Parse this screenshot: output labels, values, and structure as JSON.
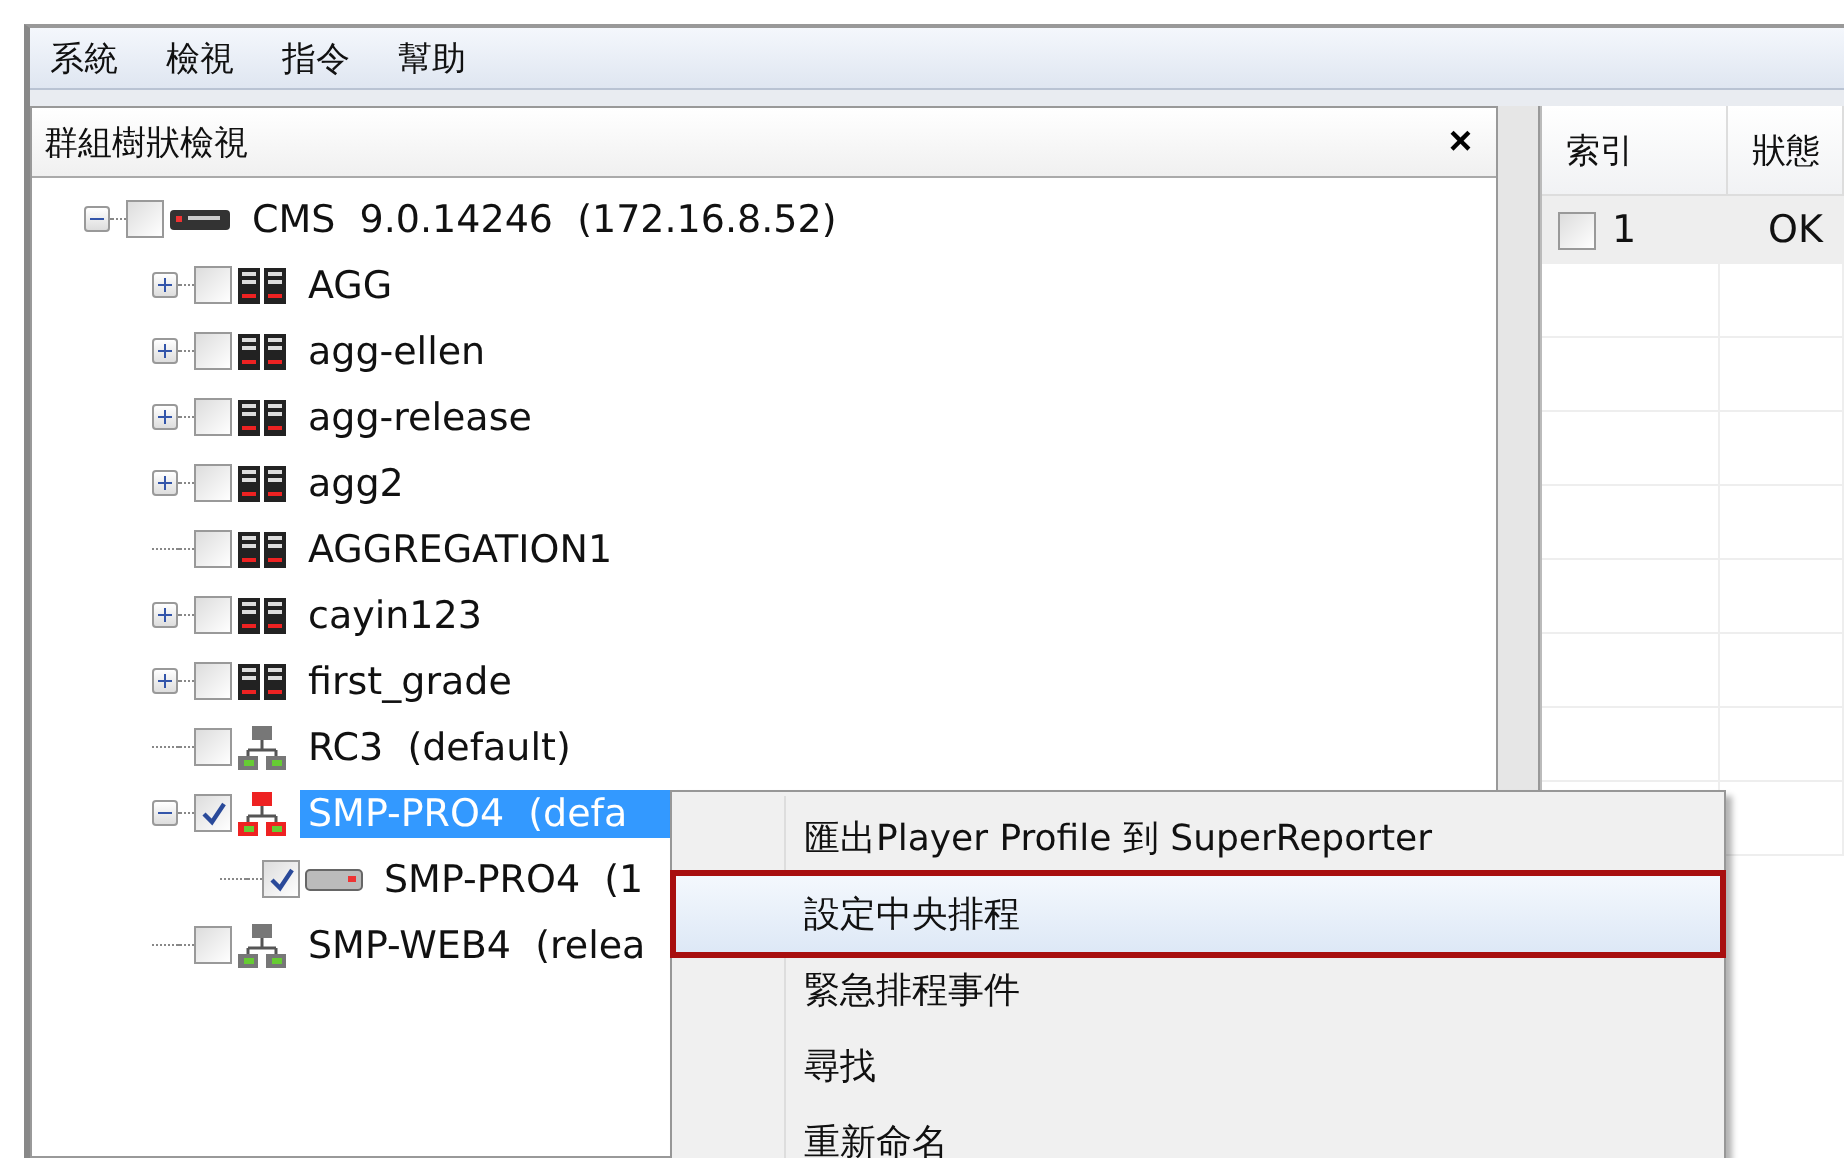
{
  "menu_bar": [
    "系統",
    "檢視",
    "指令",
    "幫助"
  ],
  "tree_panel": {
    "title": "群組樹狀檢視",
    "close": "×",
    "nodes": [
      {
        "label": "CMS  9.0.14246  (172.16.8.52)",
        "kind": "server",
        "checked": false,
        "selected": false,
        "expanded": true,
        "children": [
          {
            "label": "AGG",
            "kind": "group",
            "checked": false,
            "selected": false,
            "expanded": false
          },
          {
            "label": "agg-ellen",
            "kind": "group",
            "checked": false,
            "selected": false,
            "expanded": false
          },
          {
            "label": "agg-release",
            "kind": "group",
            "checked": false,
            "selected": false,
            "expanded": false
          },
          {
            "label": "agg2",
            "kind": "group",
            "checked": false,
            "selected": false,
            "expanded": false
          },
          {
            "label": "AGGREGATION1",
            "kind": "group",
            "checked": false,
            "selected": false
          },
          {
            "label": "cayin123",
            "kind": "group",
            "checked": false,
            "selected": false,
            "expanded": false
          },
          {
            "label": "first_grade",
            "kind": "group",
            "checked": false,
            "selected": false,
            "expanded": false
          },
          {
            "label": "RC3  (default)",
            "kind": "network",
            "checked": false,
            "selected": false
          },
          {
            "label": "SMP-PRO4  (defa",
            "kind": "network",
            "checked": true,
            "selected": true,
            "expanded": true,
            "children": [
              {
                "label": "SMP-PRO4  (1",
                "kind": "player",
                "checked": true,
                "selected": false
              }
            ]
          },
          {
            "label": "SMP-WEB4  (relea",
            "kind": "network",
            "checked": false,
            "selected": false
          }
        ]
      }
    ]
  },
  "table": {
    "columns": [
      "索引",
      "狀態"
    ],
    "rows": [
      {
        "checked": false,
        "cells": [
          "1",
          "OK"
        ]
      }
    ]
  },
  "context_menu": [
    {
      "label": "匯出Player Profile 到 SuperReporter",
      "selected": false
    },
    {
      "label": "設定中央排程",
      "selected": true
    },
    {
      "label": "緊急排程事件",
      "selected": false
    },
    {
      "label": "尋找",
      "selected": false
    },
    {
      "label": "重新命名",
      "selected": false
    }
  ]
}
